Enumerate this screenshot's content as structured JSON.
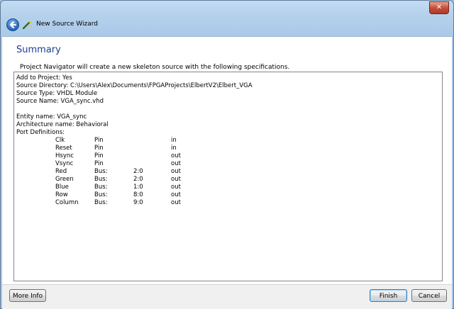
{
  "window": {
    "title": "New Source Wizard",
    "close_symbol": "✕"
  },
  "page": {
    "heading": "Summary",
    "intro": "Project Navigator will create a new skeleton source with the following specifications."
  },
  "specs": {
    "lines": [
      "Add to Project: Yes",
      "Source Directory: C:\\Users\\Alex\\Documents\\FPGAProjects\\ElbertV2\\Elbert_VGA",
      "Source Type: VHDL Module",
      "Source Name: VGA_sync.vhd",
      "",
      "Entity name: VGA_sync",
      "Architecture name: Behavioral",
      "Port Definitions:"
    ],
    "ports": [
      {
        "name": "Clk",
        "kind": "Pin",
        "range": "",
        "dir": "in"
      },
      {
        "name": "Reset",
        "kind": "Pin",
        "range": "",
        "dir": "in"
      },
      {
        "name": "Hsync",
        "kind": "Pin",
        "range": "",
        "dir": "out"
      },
      {
        "name": "Vsync",
        "kind": "Pin",
        "range": "",
        "dir": "out"
      },
      {
        "name": "Red",
        "kind": "Bus:",
        "range": "2:0",
        "dir": "out"
      },
      {
        "name": "Green",
        "kind": "Bus:",
        "range": "2:0",
        "dir": "out"
      },
      {
        "name": "Blue",
        "kind": "Bus:",
        "range": "1:0",
        "dir": "out"
      },
      {
        "name": "Row",
        "kind": "Bus:",
        "range": "8:0",
        "dir": "out"
      },
      {
        "name": "Column",
        "kind": "Bus:",
        "range": "9:0",
        "dir": "out"
      }
    ]
  },
  "footer": {
    "more_info_label": "More Info",
    "finish_label": "Finish",
    "cancel_label": "Cancel"
  },
  "icons": {
    "back": "back-arrow-icon",
    "wizard": "wizard-wand-icon",
    "close": "close-icon"
  }
}
